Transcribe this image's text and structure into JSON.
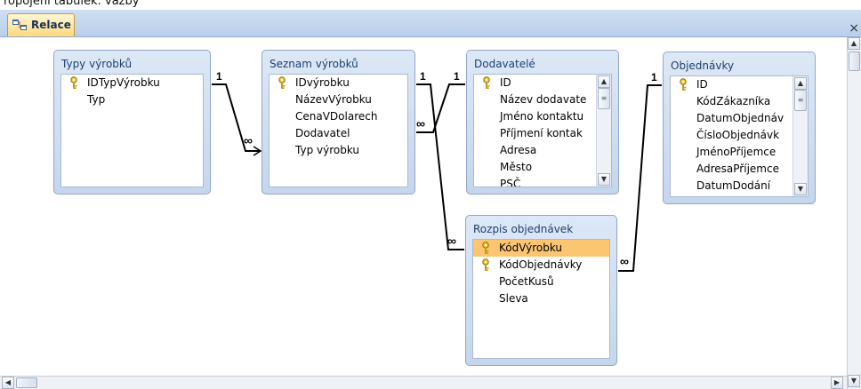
{
  "top_strip_text": "ropojení tabulek: vazby",
  "tab": {
    "label": "Relace",
    "icon": "relationships-icon"
  },
  "close_glyph": "×",
  "tables": [
    {
      "title": "Typy výrobků",
      "fields": [
        {
          "name": "IDTypVýrobku",
          "key": true
        },
        {
          "name": "Typ",
          "key": false
        }
      ]
    },
    {
      "title": "Seznam výrobků",
      "fields": [
        {
          "name": "IDvýrobku",
          "key": true
        },
        {
          "name": "NázevVýrobku",
          "key": false
        },
        {
          "name": "CenaVDolarech",
          "key": false
        },
        {
          "name": "Dodavatel",
          "key": false
        },
        {
          "name": "Typ výrobku",
          "key": false
        }
      ]
    },
    {
      "title": "Dodavatelé",
      "fields": [
        {
          "name": "ID",
          "key": true
        },
        {
          "name": "Název dodavate",
          "key": false
        },
        {
          "name": "Jméno kontaktu",
          "key": false
        },
        {
          "name": "Příjmení kontak",
          "key": false
        },
        {
          "name": "Adresa",
          "key": false
        },
        {
          "name": "Město",
          "key": false
        },
        {
          "name": "PSČ",
          "key": false
        }
      ]
    },
    {
      "title": "Objednávky",
      "fields": [
        {
          "name": "ID",
          "key": true
        },
        {
          "name": "KódZákazníka",
          "key": false
        },
        {
          "name": "DatumObjednáv",
          "key": false
        },
        {
          "name": "ČísloObjednávk",
          "key": false
        },
        {
          "name": "JménoPříjemce",
          "key": false
        },
        {
          "name": "AdresaPříjemce",
          "key": false
        },
        {
          "name": "DatumDodání",
          "key": false
        }
      ]
    },
    {
      "title": "Rozpis objednávek",
      "fields": [
        {
          "name": "KódVýrobku",
          "key": true,
          "selected": true
        },
        {
          "name": "KódObjednávky",
          "key": true
        },
        {
          "name": "PočetKusů",
          "key": false
        },
        {
          "name": "Sleva",
          "key": false
        }
      ]
    }
  ],
  "relationships": [
    {
      "one_label": "1",
      "many_label": "∞"
    },
    {
      "one_label": "1",
      "many_label": "∞"
    },
    {
      "one_label": "1",
      "many_label": "∞"
    },
    {
      "one_label": "1",
      "many_label": "∞"
    }
  ],
  "colors": {
    "tab_bar": "#b9cfea",
    "table_header": "#c5d6ed",
    "selected_row": "#fbc572",
    "link_line": "#000000"
  }
}
